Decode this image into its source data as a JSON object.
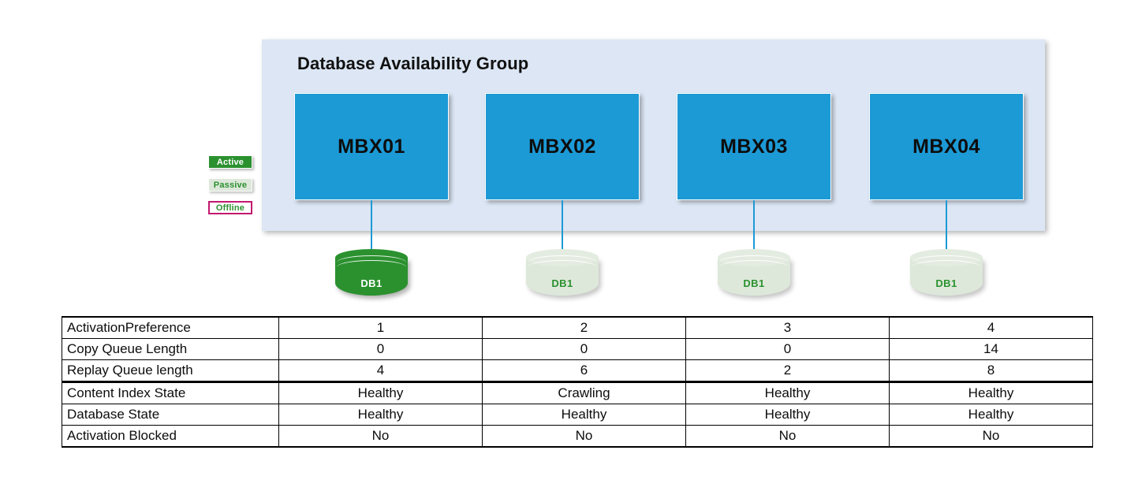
{
  "diagram": {
    "panel_title": "Database Availability Group",
    "panel_color": "#dce6f4",
    "server_color": "#1c9ad6",
    "connector_color": "#1c9ad6",
    "active_color": "#2b912f",
    "passive_color": "#dde8da",
    "offline_border_color": "#c2186f"
  },
  "legend": {
    "items": [
      {
        "label": "Active",
        "state": "active"
      },
      {
        "label": "Passive",
        "state": "passive"
      },
      {
        "label": "Offline",
        "state": "offline"
      }
    ]
  },
  "servers": [
    {
      "name": "MBX01",
      "db_label": "DB1",
      "db_state": "active"
    },
    {
      "name": "MBX02",
      "db_label": "DB1",
      "db_state": "passive"
    },
    {
      "name": "MBX03",
      "db_label": "DB1",
      "db_state": "passive"
    },
    {
      "name": "MBX04",
      "db_label": "DB1",
      "db_state": "passive"
    }
  ],
  "table": {
    "rows": [
      {
        "label": "ActivationPreference",
        "values": [
          "1",
          "2",
          "3",
          "4"
        ]
      },
      {
        "label": "Copy Queue Length",
        "values": [
          "0",
          "0",
          "0",
          "14"
        ]
      },
      {
        "label": "Replay Queue length",
        "values": [
          "4",
          "6",
          "2",
          "8"
        ]
      },
      {
        "label": "Content Index State",
        "values": [
          "Healthy",
          "Crawling",
          "Healthy",
          "Healthy"
        ]
      },
      {
        "label": "Database State",
        "values": [
          "Healthy",
          "Healthy",
          "Healthy",
          "Healthy"
        ]
      },
      {
        "label": "Activation Blocked",
        "values": [
          "No",
          "No",
          "No",
          "No"
        ]
      }
    ]
  }
}
